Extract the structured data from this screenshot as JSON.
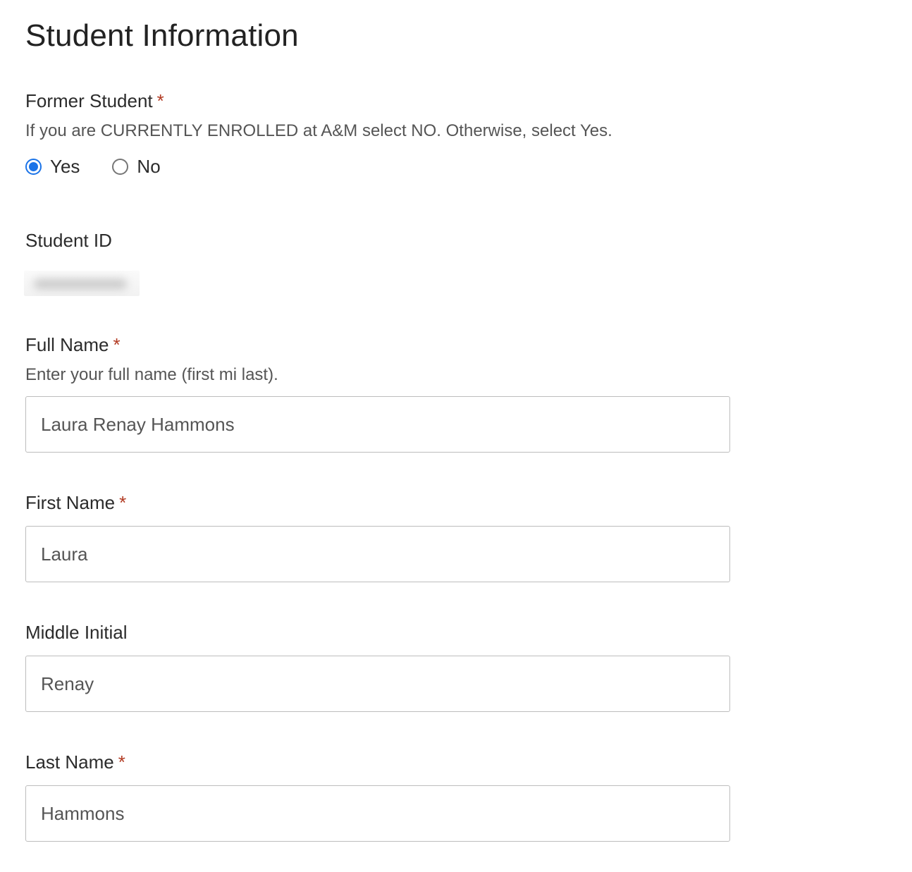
{
  "page_title": "Student Information",
  "former_student": {
    "label": "Former Student",
    "required_mark": "*",
    "help": "If you are CURRENTLY ENROLLED at A&M select NO. Otherwise, select Yes.",
    "options": [
      {
        "label": "Yes",
        "selected": true
      },
      {
        "label": "No",
        "selected": false
      }
    ]
  },
  "student_id": {
    "label": "Student ID"
  },
  "full_name": {
    "label": "Full Name",
    "required_mark": "*",
    "help": "Enter your full name (first mi last).",
    "value": "Laura Renay Hammons"
  },
  "first_name": {
    "label": "First Name",
    "required_mark": "*",
    "value": "Laura"
  },
  "middle_initial": {
    "label": "Middle Initial",
    "value": "Renay"
  },
  "last_name": {
    "label": "Last Name",
    "required_mark": "*",
    "value": "Hammons"
  },
  "colors": {
    "accent": "#1a73e8",
    "required": "#b23a22",
    "border": "#bdbdbd"
  }
}
